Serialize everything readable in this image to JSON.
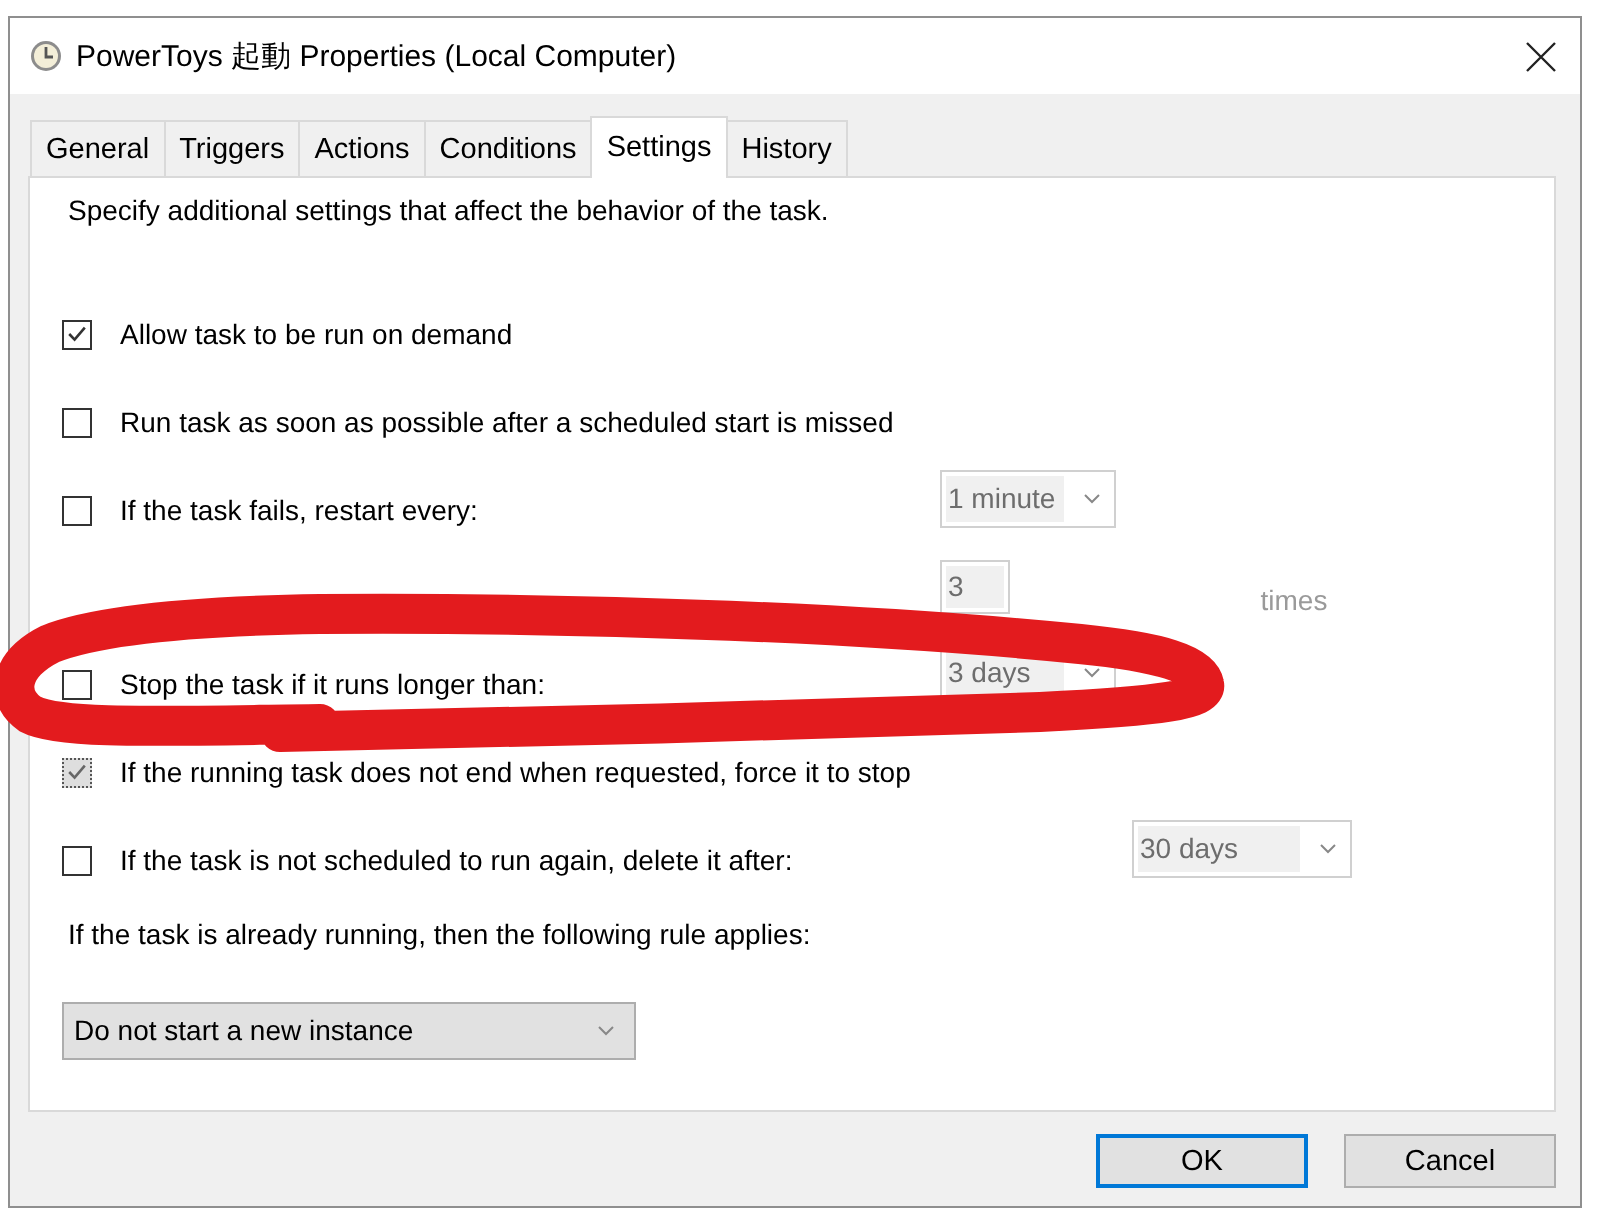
{
  "window": {
    "title": "PowerToys 起動 Properties (Local Computer)"
  },
  "tabs": [
    {
      "label": "General",
      "selected": false
    },
    {
      "label": "Triggers",
      "selected": false
    },
    {
      "label": "Actions",
      "selected": false
    },
    {
      "label": "Conditions",
      "selected": false
    },
    {
      "label": "Settings",
      "selected": true
    },
    {
      "label": "History",
      "selected": false
    }
  ],
  "description": "Specify additional settings that affect the behavior of the task.",
  "options": [
    {
      "kind": "checkbox",
      "label": "Allow task to be run on demand",
      "checked": true,
      "disabled": false
    },
    {
      "kind": "checkbox",
      "label": "Run task as soon as possible after a scheduled start is missed",
      "checked": false,
      "disabled": false
    },
    {
      "kind": "checkbox",
      "label": "If the task fails, restart every:",
      "checked": false,
      "disabled": false,
      "control": {
        "kind": "dropdown",
        "value": "1 minute",
        "disabled": true
      }
    },
    {
      "kind": "sub",
      "control": {
        "kind": "field",
        "value": "3",
        "disabled": true
      },
      "unit": "times"
    },
    {
      "kind": "checkbox",
      "label": "Stop the task if it runs longer than:",
      "checked": false,
      "disabled": false,
      "control": {
        "kind": "dropdown",
        "value": "3 days",
        "disabled": true
      }
    },
    {
      "kind": "checkbox",
      "label": "If the running task does not end when requested, force it to stop",
      "checked": true,
      "disabled": true
    },
    {
      "kind": "checkbox",
      "label": "If the task is not scheduled to run again, delete it after:",
      "checked": false,
      "disabled": false,
      "control": {
        "kind": "dropdown",
        "value": "30 days",
        "disabled": true
      }
    }
  ],
  "rule": {
    "label": "If the task is already running, then the following rule applies:",
    "control": {
      "kind": "dropdown",
      "value": "Do not start a new instance",
      "disabled": false
    }
  },
  "buttons": [
    {
      "label": "OK",
      "default": true
    },
    {
      "label": "Cancel",
      "default": false
    }
  ]
}
